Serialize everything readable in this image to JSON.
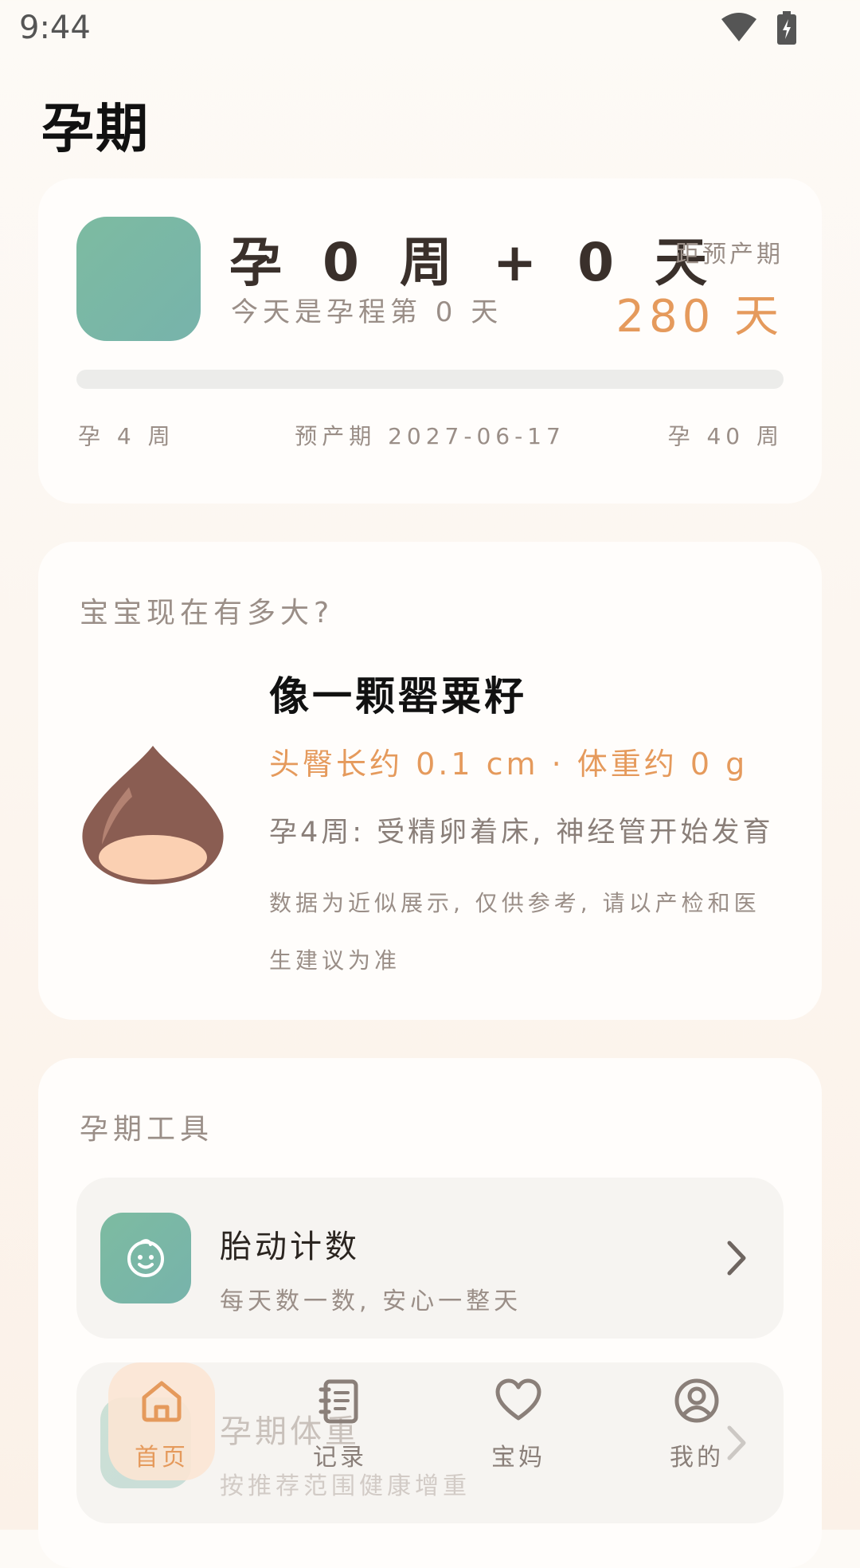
{
  "status_bar": {
    "time": "9:44"
  },
  "page": {
    "title": "孕期"
  },
  "progress": {
    "weeks_title": "孕 0 周 + 0 天",
    "today_text": "今天是孕程第 0 天",
    "due_label": "距预产期",
    "due_days": "280 天",
    "progress_fraction": 0,
    "scale_start": "孕 4 周",
    "due_date": "预产期 2027-06-17",
    "scale_end": "孕 40 周"
  },
  "baby_size": {
    "section_label": "宝宝现在有多大?",
    "fruit_title": "像一颗罂粟籽",
    "measurements": "头臀长约 0.1 cm · 体重约 0 g",
    "development": "孕4周: 受精卵着床, 神经管开始发育",
    "note": "数据为近似展示, 仅供参考, 请以产检和医生建议为准"
  },
  "tools": {
    "section_label": "孕期工具",
    "items": [
      {
        "title": "胎动计数",
        "subtitle": "每天数一数, 安心一整天",
        "icon": "baby-face-icon"
      },
      {
        "title": "孕期体重",
        "subtitle": "按推荐范围健康增重",
        "icon": "scale-icon"
      }
    ]
  },
  "bottom_nav": {
    "items": [
      {
        "label": "首页",
        "icon": "home-icon",
        "active": true
      },
      {
        "label": "记录",
        "icon": "notebook-icon",
        "active": false
      },
      {
        "label": "宝妈",
        "icon": "heart-icon",
        "active": false
      },
      {
        "label": "我的",
        "icon": "profile-icon",
        "active": false
      }
    ]
  },
  "colors": {
    "accent": "#e59a5c",
    "brand_green": "#7dbba1",
    "chestnut": "#8a5d52"
  }
}
